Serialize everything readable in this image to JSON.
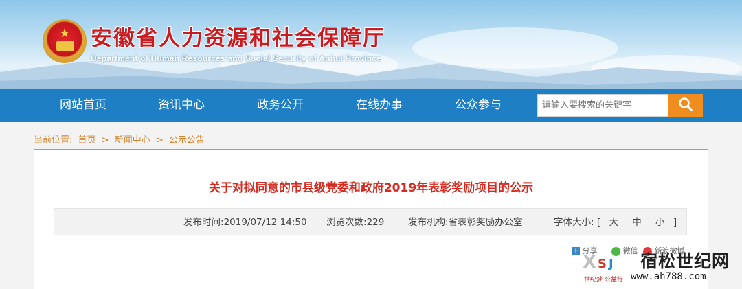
{
  "header": {
    "site_title": "安徽省人力资源和社会保障厅",
    "site_subtitle": "Department of Human Resources and Social Security of Anhui Province",
    "emblem_icon": "national-emblem-icon"
  },
  "nav": {
    "items": [
      {
        "label": "网站首页"
      },
      {
        "label": "资讯中心"
      },
      {
        "label": "政务公开"
      },
      {
        "label": "在线办事"
      },
      {
        "label": "公众参与"
      }
    ],
    "search": {
      "placeholder": "请输入要搜索的关键字",
      "icon": "search-icon"
    }
  },
  "breadcrumb": {
    "prefix": "当前位置:",
    "items": [
      "首页",
      "新闻中心",
      "公示公告"
    ],
    "separator": ">"
  },
  "article": {
    "title": "关于对拟同意的市县级党委和政府2019年表彰奖励项目的公示",
    "meta": {
      "publish_time_label": "发布时间:",
      "publish_time": "2019/07/12 14:50",
      "views_label": "浏览次数:",
      "views": "229",
      "publisher_label": "发布机构:",
      "publisher": "省表彰奖励办公室",
      "font_size_label": "字体大小:",
      "font_size_open": "[",
      "font_large": "大",
      "font_medium": "中",
      "font_small": "小",
      "font_size_close": "]"
    }
  },
  "share": {
    "share_label": "分享",
    "wechat_label": "微信",
    "weibo_label": "新浪微博"
  },
  "watermark": {
    "text": "宿松世纪网",
    "url": "www.ah788.com",
    "small_text": "世纪梦 公益行",
    "logo_letters": "XSJ"
  },
  "colors": {
    "nav_bg": "#1f7fc4",
    "accent_orange": "#f08d1e",
    "title_red": "#d42a1f",
    "breadcrumb_orange": "#d3822a"
  }
}
